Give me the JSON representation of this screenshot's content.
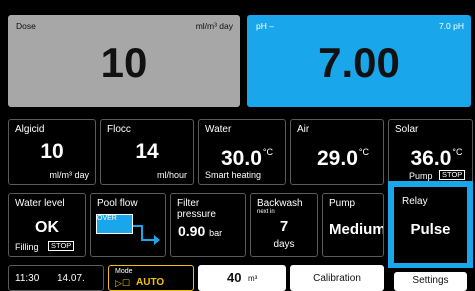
{
  "dose": {
    "label": "Dose",
    "unit": "ml/m³ day",
    "value": "10"
  },
  "ph": {
    "label": "pH –",
    "setpoint": "7.0 pH",
    "value": "7.00"
  },
  "row2": {
    "algicid": {
      "label": "Algicid",
      "value": "10",
      "unit": "ml/m³ day"
    },
    "flocc": {
      "label": "Flocc",
      "value": "14",
      "unit": "ml/hour"
    },
    "water": {
      "label": "Water",
      "value": "30.0",
      "deg": "°C",
      "note": "Smart heating"
    },
    "air": {
      "label": "Air",
      "value": "29.0",
      "deg": "°C"
    },
    "solar": {
      "label": "Solar",
      "value": "36.0",
      "deg": "°C",
      "pump_label": "Pump",
      "stop": "STOP"
    }
  },
  "row3": {
    "water_level": {
      "label": "Water level",
      "value": "OK",
      "sub": "Filling",
      "stop": "STOP"
    },
    "pool_flow": {
      "label": "Pool flow",
      "over": "OVER"
    },
    "filter_pressure": {
      "label": "Filter pressure",
      "value": "0.90",
      "unit": "bar"
    },
    "backwash": {
      "label": "Backwash",
      "sub": "next in",
      "value": "7",
      "unit": "days"
    },
    "pump": {
      "label": "Pump",
      "value": "Medium"
    },
    "relay": {
      "label": "Relay",
      "value": "Pulse"
    }
  },
  "bottom": {
    "time": "11:30",
    "date": "14.07.",
    "mode_label": "Mode",
    "mode_value": "AUTO",
    "volume_value": "40",
    "volume_unit": "m³",
    "calibration": "Calibration",
    "settings": "Settings"
  },
  "colors": {
    "accent_blue": "#1aa6ea",
    "dose_gray": "#a7a7a7",
    "mode_yellow": "#f2c200"
  }
}
